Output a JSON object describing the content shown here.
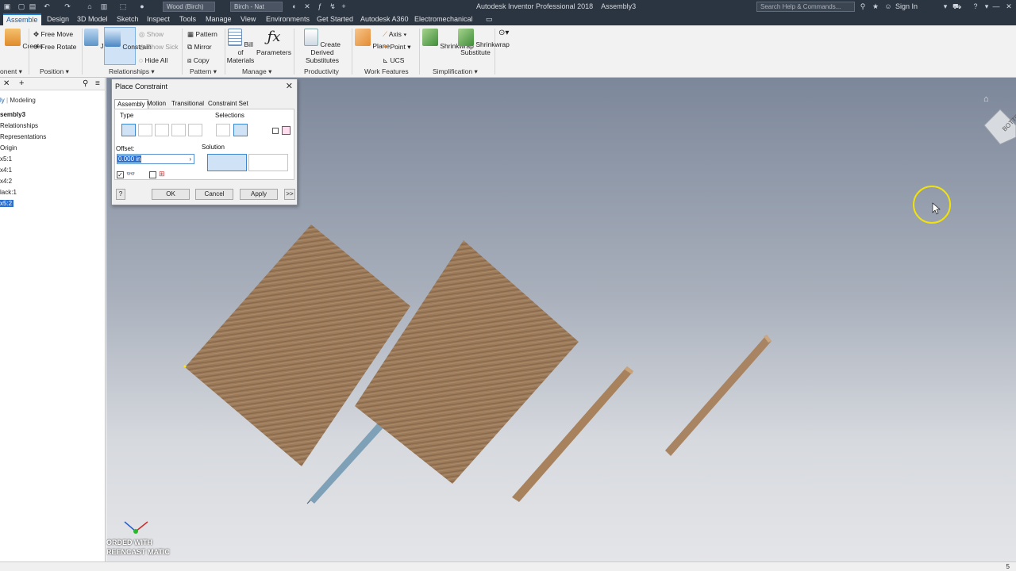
{
  "quick_access": {
    "material": "Wood (Birch)",
    "appearance": "Birch - Nat"
  },
  "app_title": "Autodesk Inventor Professional 2018",
  "document": "Assembly3",
  "search_placeholder": "Search Help & Commands...",
  "sign_in": "Sign In",
  "tabs": [
    "Assemble",
    "Design",
    "3D Model",
    "Sketch",
    "Inspect",
    "Tools",
    "Manage",
    "View",
    "Environments",
    "Get Started",
    "Autodesk A360",
    "Electromechanical"
  ],
  "ribbon": {
    "component": {
      "create": "Create",
      "group": "onent"
    },
    "position": {
      "free_move": "Free Move",
      "free_rotate": "Free Rotate",
      "group": "Position"
    },
    "relationships": {
      "joint": "Joint",
      "constrain": "Constrain",
      "show": "Show",
      "show_sick": "Show Sick",
      "hide_all": "Hide All",
      "group": "Relationships"
    },
    "pattern": {
      "pattern": "Pattern",
      "mirror": "Mirror",
      "copy": "Copy",
      "group": "Pattern"
    },
    "manage": {
      "bom": "Bill of\nMaterials",
      "parameters": "Parameters",
      "group": "Manage"
    },
    "productivity": {
      "create_derived": "Create Derived\nSubstitutes",
      "group": "Productivity"
    },
    "work_features": {
      "plane": "Plane",
      "axis": "Axis",
      "point": "Point",
      "ucs": "UCS",
      "group": "Work Features"
    },
    "simplification": {
      "shrinkwrap": "Shrinkwrap",
      "shrinkwrap_sub": "Shrinkwrap\nSubstitute",
      "group": "Simplification"
    }
  },
  "browser": {
    "tab_assembly": "ly",
    "tab_modeling": "Modeling",
    "items": [
      "sembly3",
      "Relationships",
      "Representations",
      "Origin",
      "x5:1",
      "x4:1",
      "x4:2",
      "lack:1",
      "x5:2"
    ]
  },
  "dialog": {
    "title": "Place Constraint",
    "tabs": [
      "Assembly",
      "Motion",
      "Transitional",
      "Constraint Set"
    ],
    "type_label": "Type",
    "selections_label": "Selections",
    "offset_label": "Offset:",
    "offset_value": "0.000 in",
    "solution_label": "Solution",
    "ok": "OK",
    "cancel": "Cancel",
    "apply": "Apply",
    "more": ">>"
  },
  "viewcube_label": "BOTTOM",
  "watermark": "ORDED WITH\nREENCAST MATIC",
  "status_count": "5",
  "colors": {
    "accent": "#1b7cd0",
    "titlebar": "#2b3441",
    "wood": "#9a7a5a"
  }
}
